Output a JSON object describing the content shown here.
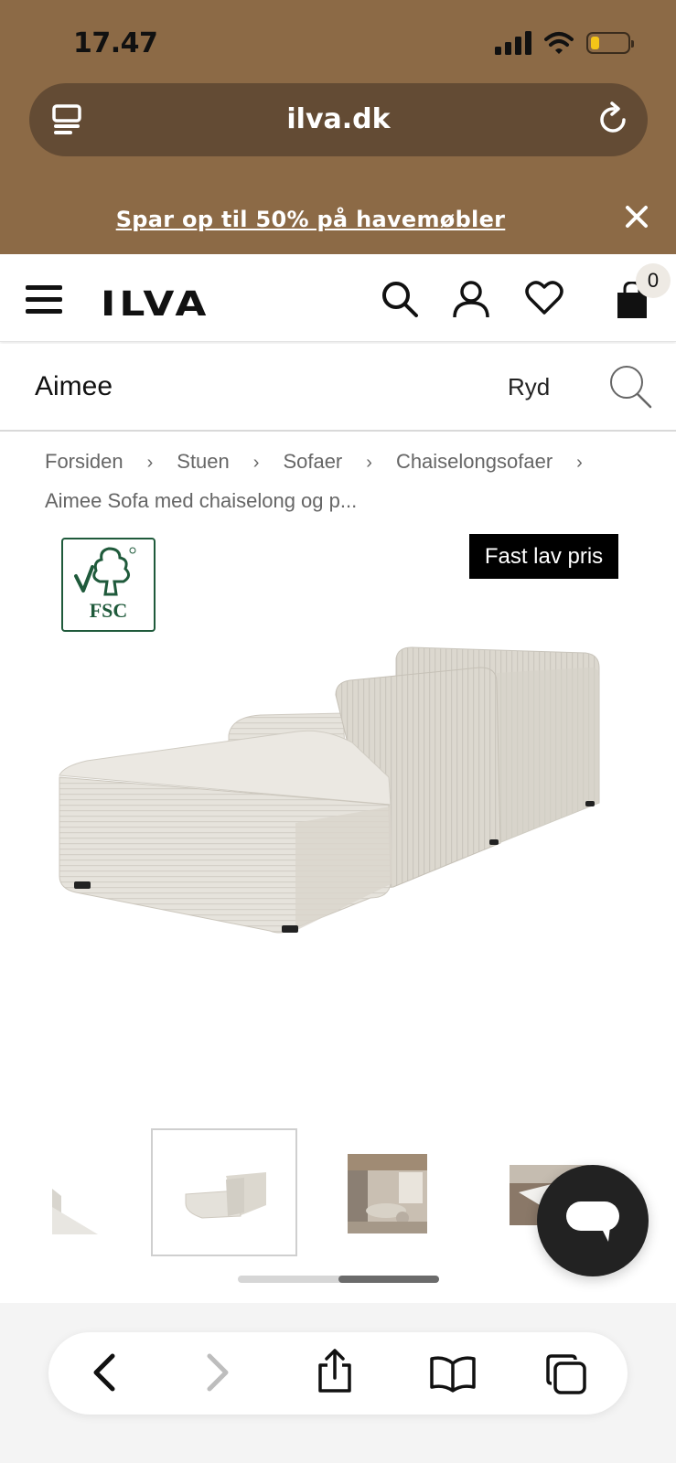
{
  "status_bar": {
    "time": "17.47"
  },
  "browser": {
    "url": "ilva.dk"
  },
  "promo": {
    "text": "Spar op til 50% på havemøbler"
  },
  "header": {
    "logo": "ILVA",
    "cart_count": "0"
  },
  "search": {
    "value": "Aimee",
    "clear_label": "Ryd"
  },
  "breadcrumb": {
    "items": [
      "Forsiden",
      "Stuen",
      "Sofaer",
      "Chaiselongsofaer"
    ],
    "separator": "›",
    "current": "Aimee Sofa med chaiselong og p..."
  },
  "product": {
    "certification_label": "FSC",
    "badge": "Fast lav pris",
    "thumbnail_count": 4,
    "active_thumbnail": 2,
    "carousel_position": 0.5
  },
  "colors": {
    "browser_header": "#8c6a46",
    "url_bar": "#634b34",
    "badge_bg": "#000000",
    "fsc_green": "#1f5a3b"
  },
  "icons": {
    "browser": [
      "reader-icon",
      "reload-icon",
      "close-icon"
    ],
    "header": [
      "menu-icon",
      "search-icon",
      "account-icon",
      "heart-icon",
      "bag-icon"
    ],
    "toolbar": [
      "back-icon",
      "forward-icon",
      "share-icon",
      "bookmarks-icon",
      "tabs-icon"
    ],
    "chat": "chat-icon"
  }
}
